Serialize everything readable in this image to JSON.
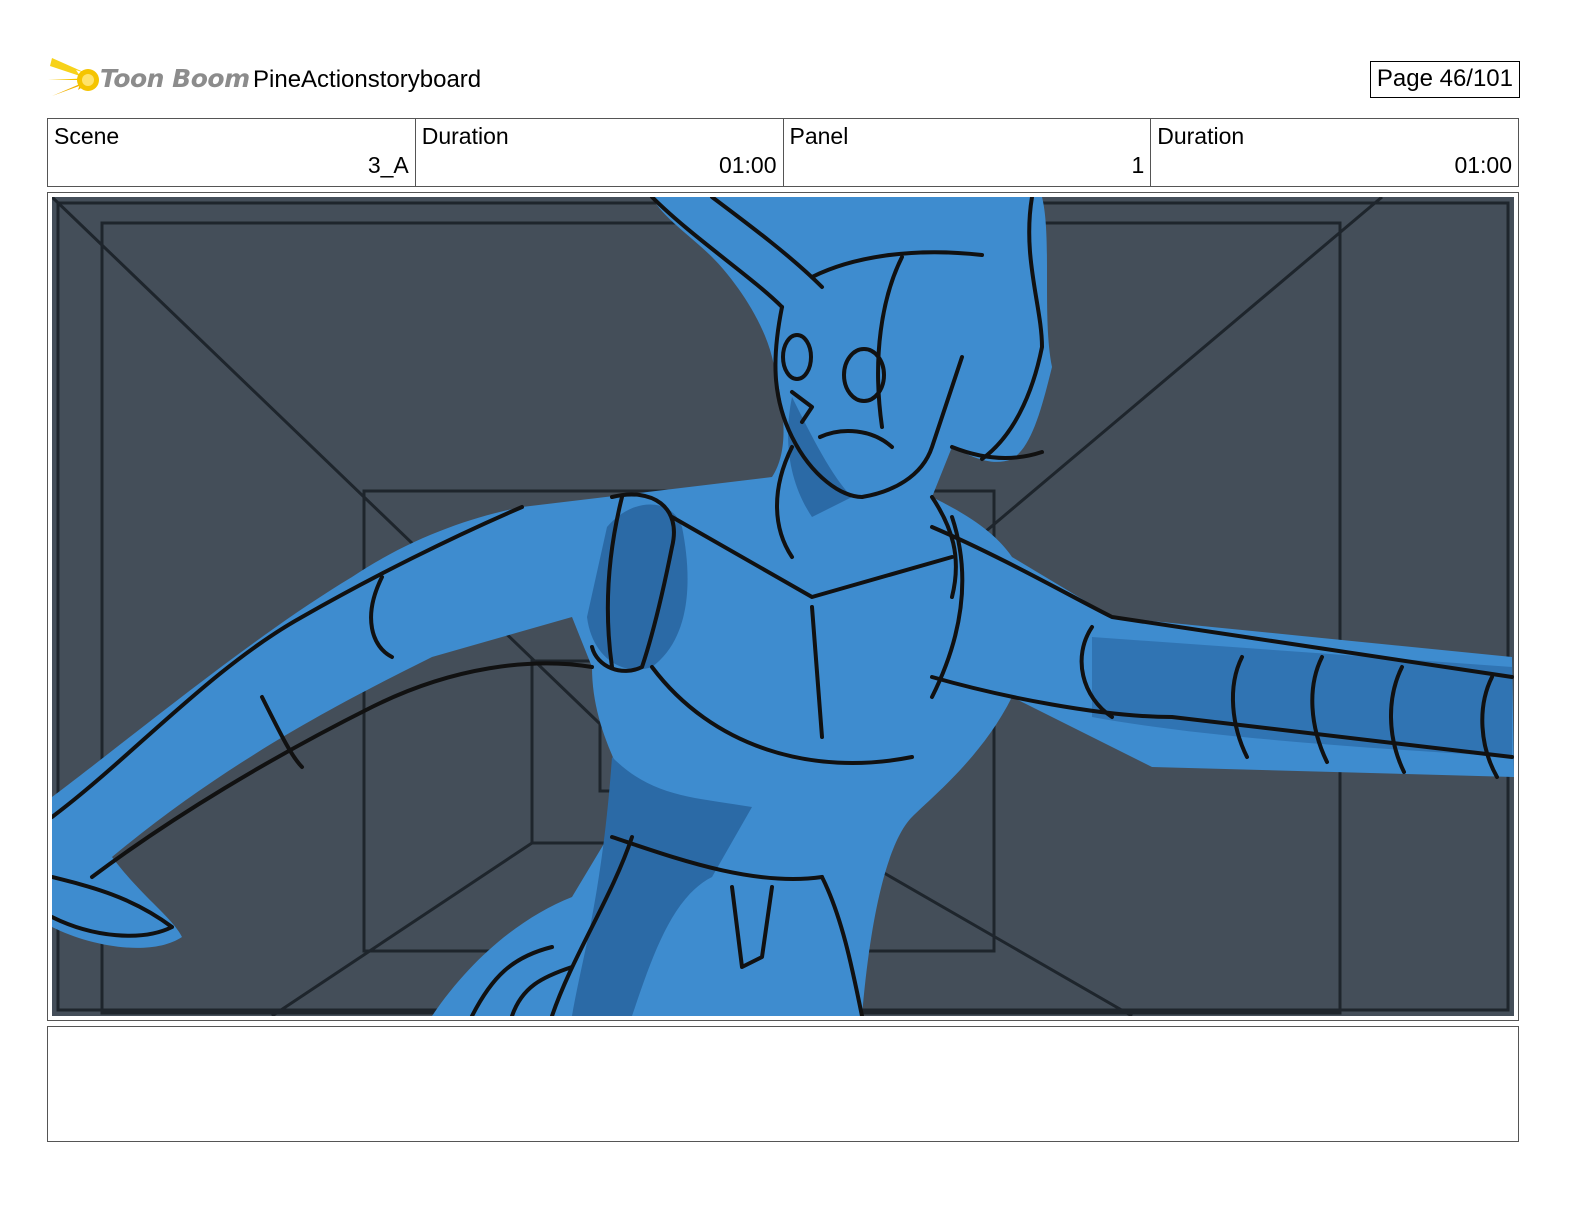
{
  "header": {
    "logo_text": "Toon Boom",
    "project_title": "PineActionstoryboard",
    "page_label": "Page 46/101"
  },
  "info": {
    "scene_label": "Scene",
    "scene_value": "3_A",
    "scene_duration_label": "Duration",
    "scene_duration_value": "01:00",
    "panel_label": "Panel",
    "panel_value": "1",
    "panel_duration_label": "Duration",
    "panel_duration_value": "01:00"
  },
  "notes": {
    "text": ""
  },
  "colors": {
    "background_wall": "#444e59",
    "character_fill": "#3e8ccf",
    "character_shadow": "#2b6aa6",
    "line": "#111111",
    "logo_star": "#f5c400"
  }
}
